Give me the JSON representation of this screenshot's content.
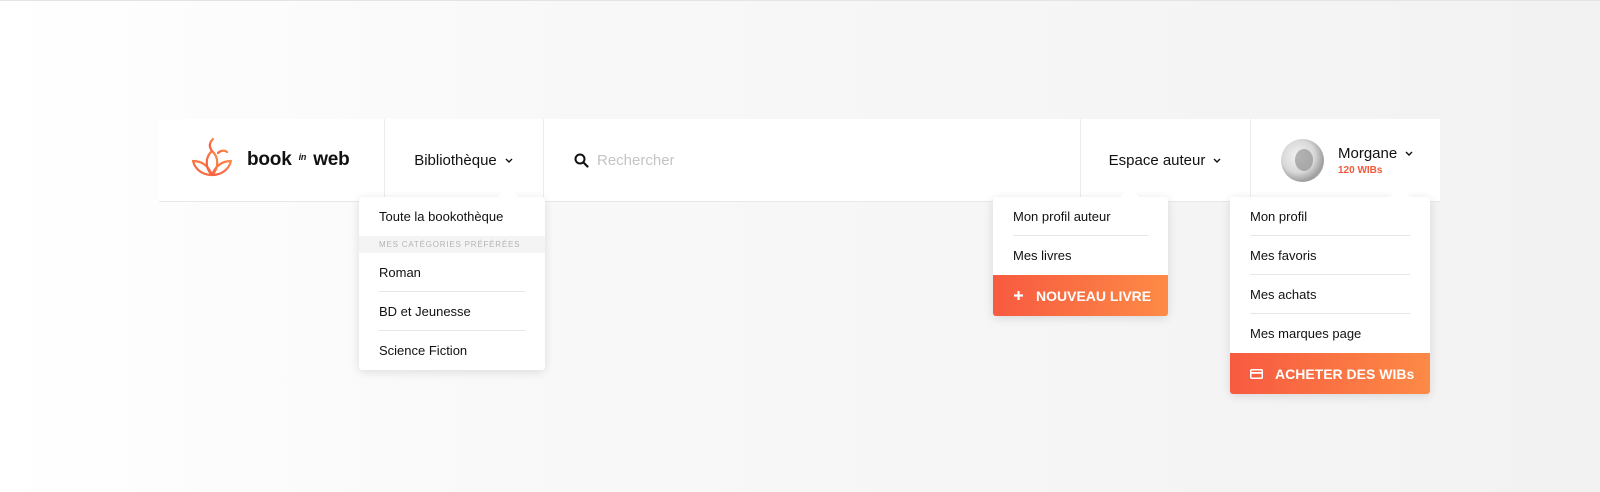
{
  "brand": {
    "name_left": "book",
    "name_mid": "in",
    "name_right": "web",
    "logo_icon": "leaf-logo-icon",
    "accent": "#f2593a"
  },
  "nav": {
    "library_label": "Bibliothèque",
    "search_placeholder": "Rechercher",
    "author_label": "Espace auteur",
    "user": {
      "name": "Morgane",
      "wibs": "120 WIBs"
    }
  },
  "library_menu": {
    "all_label": "Toute la bookothèque",
    "category_heading": "MES CATÉGORIES PRÉFÉRÉES",
    "categories": [
      "Roman",
      "BD et Jeunesse",
      "Science Fiction"
    ]
  },
  "author_menu": {
    "items": [
      "Mon profil auteur",
      "Mes livres"
    ],
    "cta_label": "NOUVEAU LIVRE",
    "cta_icon": "plus-icon"
  },
  "user_menu": {
    "items": [
      "Mon profil",
      "Mes favoris",
      "Mes achats",
      "Mes marques page"
    ],
    "cta_label": "ACHETER DES WIBs",
    "cta_icon": "credit-card-icon"
  },
  "colors": {
    "cta_start": "#f75a40",
    "cta_end": "#fd8a46"
  }
}
